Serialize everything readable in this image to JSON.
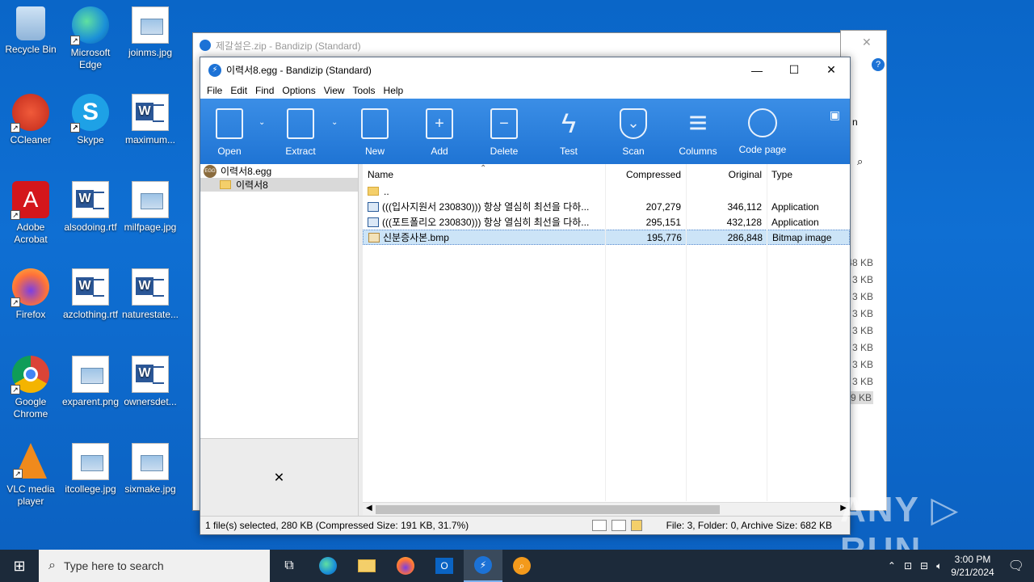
{
  "desktop": {
    "icons": [
      {
        "label": "Recycle Bin"
      },
      {
        "label": "Microsoft Edge"
      },
      {
        "label": "joinms.jpg"
      },
      {
        "label": "CCleaner"
      },
      {
        "label": "Skype"
      },
      {
        "label": "maximum..."
      },
      {
        "label": "Adobe Acrobat"
      },
      {
        "label": "alsodoing.rtf"
      },
      {
        "label": "milfpage.jpg"
      },
      {
        "label": "Firefox"
      },
      {
        "label": "azclothing.rtf"
      },
      {
        "label": "naturestate..."
      },
      {
        "label": "Google Chrome"
      },
      {
        "label": "exparent.png"
      },
      {
        "label": "ownersdet..."
      },
      {
        "label": "VLC media player"
      },
      {
        "label": "itcollege.jpg"
      },
      {
        "label": "sixmake.jpg"
      }
    ]
  },
  "back_window": {
    "title": "제갈설은.zip - Bandizip (Standard)"
  },
  "right_window": {
    "sizes": [
      "48 KB",
      "3 KB",
      "3 KB",
      "3 KB",
      "3 KB",
      "3 KB",
      "3 KB",
      "3 KB",
      "79 KB"
    ],
    "n_label": "n"
  },
  "window": {
    "title": "이력서8.egg - Bandizip (Standard)",
    "minimize": "—",
    "maximize": "☐",
    "close": "✕"
  },
  "menu": [
    "File",
    "Edit",
    "Find",
    "Options",
    "View",
    "Tools",
    "Help"
  ],
  "toolbar": {
    "open": "Open",
    "extract": "Extract",
    "new": "New",
    "add": "Add",
    "delete": "Delete",
    "test": "Test",
    "scan": "Scan",
    "columns": "Columns",
    "code_page": "Code page"
  },
  "tree": {
    "archive": "이력서8.egg",
    "folder": "이력서8"
  },
  "preview_close": "✕",
  "columns": {
    "name": "Name",
    "compressed": "Compressed",
    "original": "Original",
    "type": "Type"
  },
  "files": [
    {
      "name": "..",
      "compressed": "",
      "original": "",
      "type": "",
      "kind": "folder"
    },
    {
      "name": "(((입사지원서 230830))) 항상 열심히 최선을 다하...",
      "compressed": "207,279",
      "original": "346,112",
      "type": "Application",
      "kind": "app"
    },
    {
      "name": "(((포트폴리오 230830))) 항상 열심히 최선을 다하...",
      "compressed": "295,151",
      "original": "432,128",
      "type": "Application",
      "kind": "app"
    },
    {
      "name": "신분증사본.bmp",
      "compressed": "195,776",
      "original": "286,848",
      "type": "Bitmap image",
      "kind": "bmp"
    }
  ],
  "status": {
    "selection": "1 file(s) selected, 280 KB (Compressed Size: 191 KB, 31.7%)",
    "summary": "File: 3, Folder: 0, Archive Size: 682 KB"
  },
  "taskbar": {
    "search_placeholder": "Type here to search",
    "time": "3:00 PM",
    "date": "9/21/2024"
  },
  "watermark": "ANY ▷ RUN"
}
